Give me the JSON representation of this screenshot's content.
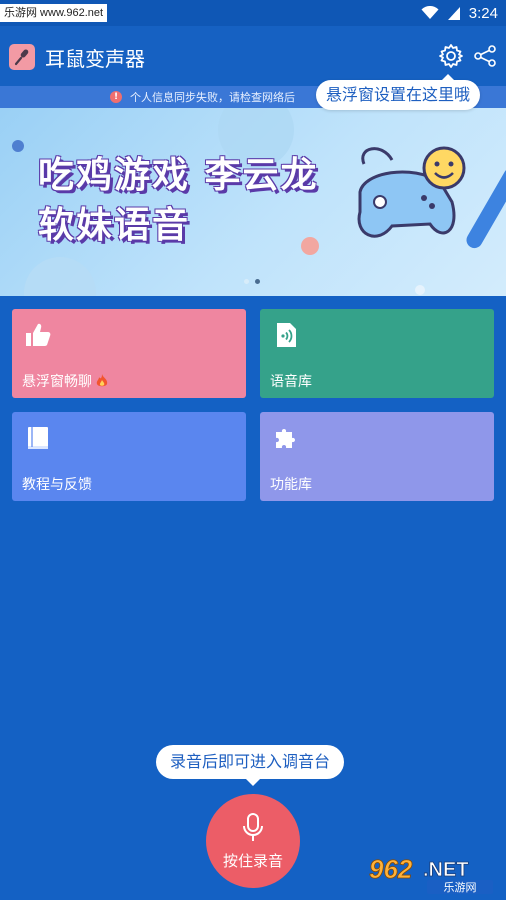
{
  "status_bar": {
    "watermark": "乐游网 www.962.net",
    "time": "3:24"
  },
  "app_bar": {
    "title": "耳鼠变声器",
    "icons": [
      "microphone-app-icon",
      "gear-icon",
      "share-icon"
    ]
  },
  "notice": {
    "text": "个人信息同步失败，请检查网络后"
  },
  "tooltip_settings": "悬浮窗设置在这里哦",
  "banner": {
    "line1": "吃鸡游戏 李云龙",
    "line2": "软妹语音",
    "page_count": 2,
    "active_page": 2
  },
  "cards": [
    {
      "label": "悬浮窗畅聊",
      "icon": "thumbs-up-icon",
      "color": "#ef86a0",
      "badge_icon": "fire-icon"
    },
    {
      "label": "语音库",
      "icon": "voice-file-icon",
      "color": "#35a28a"
    },
    {
      "label": "教程与反馈",
      "icon": "book-icon",
      "color": "#5a86ef"
    },
    {
      "label": "功能库",
      "icon": "puzzle-icon",
      "color": "#8f97ea"
    }
  ],
  "tooltip_record": "录音后即可进入调音台",
  "record_button": {
    "label": "按住录音"
  },
  "watermark_br": {
    "logo": "962.NET",
    "sub": "乐游网"
  },
  "colors": {
    "background": "#1461c4",
    "accent": "#ec5d67"
  }
}
